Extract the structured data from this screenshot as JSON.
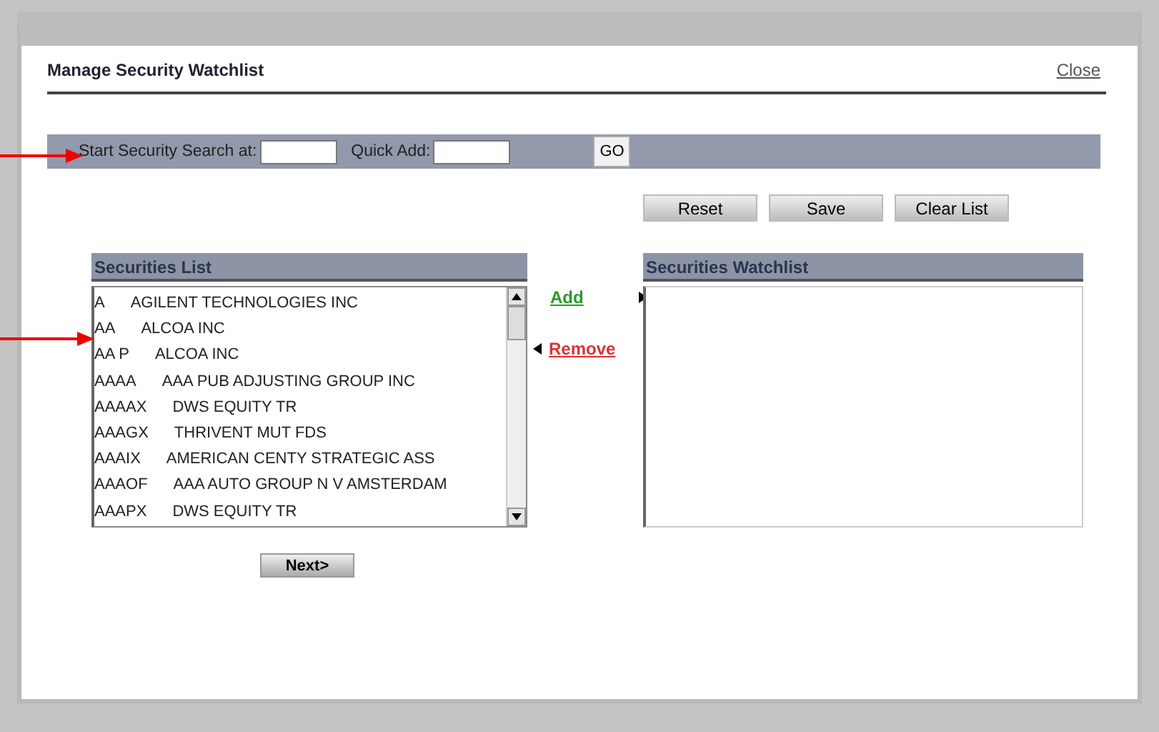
{
  "window": {
    "title": "Manage Security Watchlist",
    "close": "Close"
  },
  "search_bar": {
    "start_label": "Start Security Search at:",
    "quick_add_label": "Quick Add:",
    "go": "GO"
  },
  "buttons": [
    "Reset",
    "Save",
    "Clear List"
  ],
  "securities_list": {
    "title": "Securities List",
    "items": [
      {
        "symbol": "A",
        "name": "AGILENT TECHNOLOGIES INC"
      },
      {
        "symbol": "AA",
        "name": "ALCOA INC"
      },
      {
        "symbol": "AA P",
        "name": "ALCOA INC"
      },
      {
        "symbol": "AAAA",
        "name": "AAA PUB ADJUSTING GROUP INC"
      },
      {
        "symbol": "AAAAX",
        "name": "DWS EQUITY TR"
      },
      {
        "symbol": "AAAGX",
        "name": "THRIVENT MUT FDS"
      },
      {
        "symbol": "AAAIX",
        "name": "AMERICAN CENTY STRATEGIC ASS"
      },
      {
        "symbol": "AAAOF",
        "name": "AAA AUTO GROUP N V AMSTERDAM"
      },
      {
        "symbol": "AAAPX",
        "name": "DWS EQUITY TR"
      }
    ]
  },
  "add": "Add",
  "remove": "Remove",
  "watchlist": {
    "title": "Securities Watchlist"
  },
  "next": "Next>"
}
